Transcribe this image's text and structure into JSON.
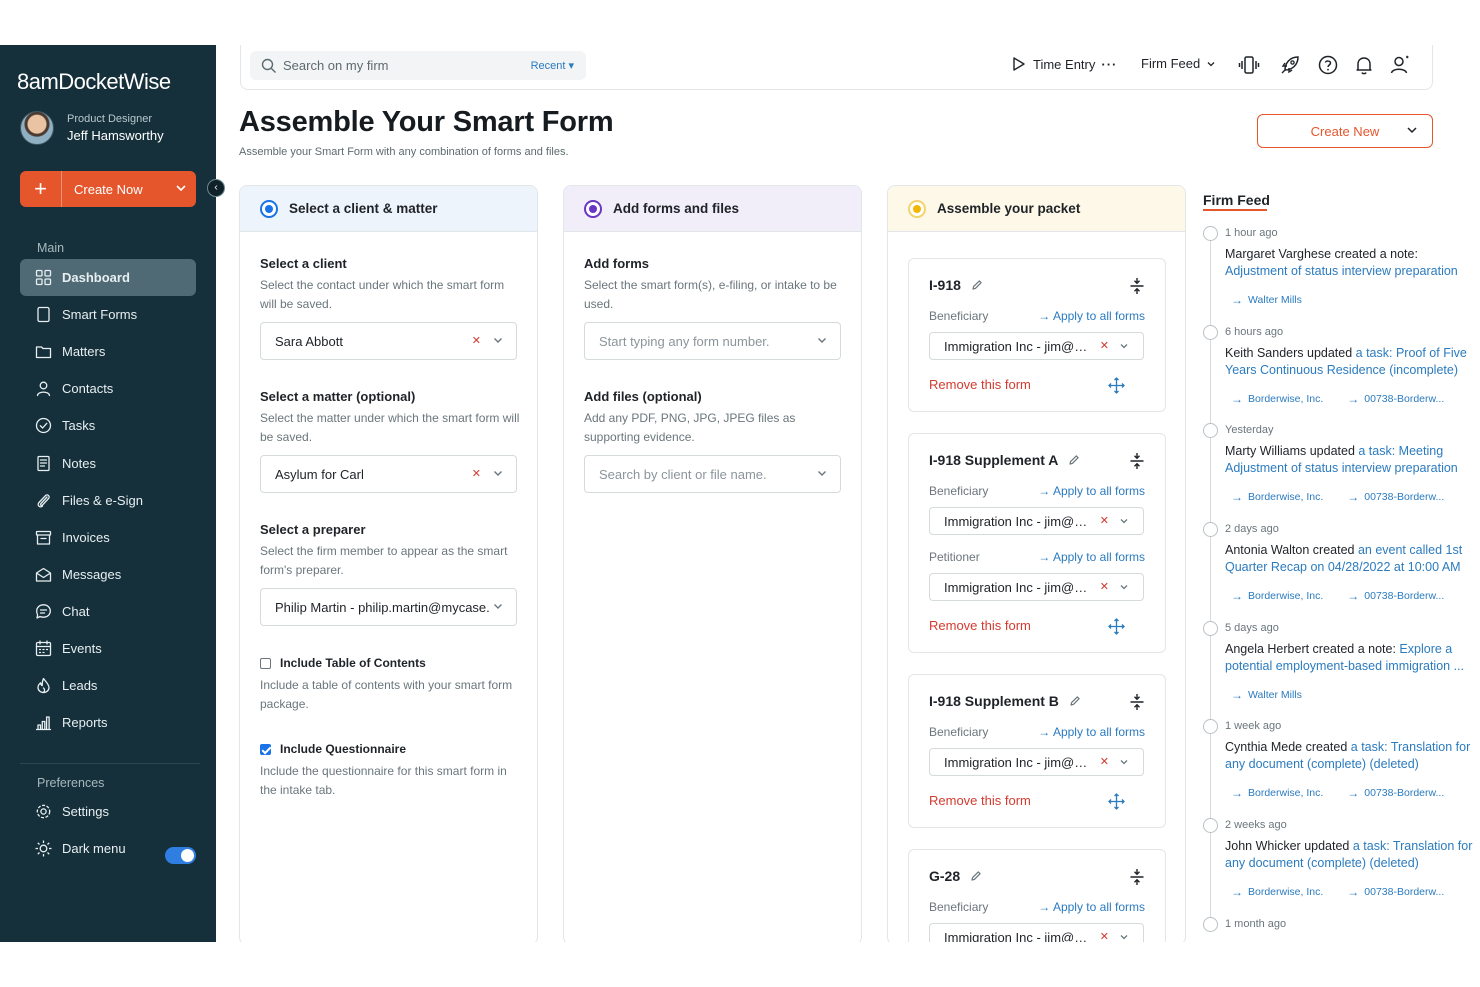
{
  "sidebar": {
    "logo": "8amDocketWise",
    "user": {
      "role": "Product Designer",
      "name": "Jeff Hamsworthy"
    },
    "create_label": "Create Now",
    "main_label": "Main",
    "items": [
      {
        "label": "Dashboard",
        "icon": "grid-icon"
      },
      {
        "label": "Smart Forms",
        "icon": "form-icon"
      },
      {
        "label": "Matters",
        "icon": "folder-icon"
      },
      {
        "label": "Contacts",
        "icon": "person-icon"
      },
      {
        "label": "Tasks",
        "icon": "check-circle-icon"
      },
      {
        "label": "Notes",
        "icon": "note-icon"
      },
      {
        "label": "Files & e-Sign",
        "icon": "paperclip-icon"
      },
      {
        "label": "Invoices",
        "icon": "invoice-icon"
      },
      {
        "label": "Messages",
        "icon": "envelope-icon"
      },
      {
        "label": "Chat",
        "icon": "chat-icon"
      },
      {
        "label": "Events",
        "icon": "calendar-icon"
      },
      {
        "label": "Leads",
        "icon": "flame-icon"
      },
      {
        "label": "Reports",
        "icon": "bar-chart-icon"
      }
    ],
    "prefs_label": "Preferences",
    "settings_label": "Settings",
    "dark_menu_label": "Dark menu",
    "dark_menu_on": true
  },
  "topbar": {
    "search_placeholder": "Search on my firm",
    "recent": "Recent ▾",
    "time_entry": "Time Entry",
    "firm_feed": "Firm Feed"
  },
  "page": {
    "title": "Assemble Your Smart Form",
    "subtitle": "Assemble your Smart Form with any combination of forms and files.",
    "create_new": "Create New"
  },
  "col1": {
    "header": "Select a client & matter",
    "client_title": "Select a client",
    "client_desc": "Select the contact under which the smart form will be saved.",
    "client_value": "Sara Abbott",
    "matter_title": "Select a matter (optional)",
    "matter_desc": "Select the matter under which the smart form will be saved.",
    "matter_value": "Asylum for Carl",
    "preparer_title": "Select a preparer",
    "preparer_desc": "Select the firm member to appear as the smart form's preparer.",
    "preparer_value": "Philip Martin - philip.martin@mycase.c",
    "toc_label": "Include Table of Contents",
    "toc_desc": "Include a table of contents with your smart form package.",
    "toc_checked": false,
    "questionnaire_label": "Include Questionnaire",
    "questionnaire_desc": "Include the questionnaire for this smart form in the intake tab.",
    "questionnaire_checked": true
  },
  "col2": {
    "header": "Add forms and files",
    "forms_title": "Add forms",
    "forms_desc": "Select the smart form(s), e-filing, or intake to be used.",
    "forms_placeholder": "Start typing any form number.",
    "files_title": "Add files (optional)",
    "files_desc": "Add any PDF, PNG, JPG, JPEG files as supporting evidence.",
    "files_placeholder": "Search by client or file name."
  },
  "col3": {
    "header": "Assemble your packet",
    "apply_label": "→ Apply to all forms",
    "remove_label": "Remove this form",
    "cards": [
      {
        "title": "I-918",
        "rows": [
          {
            "role": "Beneficiary",
            "value": "Immigration Inc - jim@gl…"
          }
        ]
      },
      {
        "title": "I-918 Supplement A",
        "rows": [
          {
            "role": "Beneficiary",
            "value": "Immigration Inc - jim@gl…"
          },
          {
            "role": "Petitioner",
            "value": "Immigration Inc - jim@gl…"
          }
        ]
      },
      {
        "title": "I-918 Supplement B",
        "rows": [
          {
            "role": "Beneficiary",
            "value": "Immigration Inc - jim@gl…"
          }
        ]
      },
      {
        "title": "G-28",
        "rows": [
          {
            "role": "Beneficiary",
            "value": "Immigration Inc - jim@gl…"
          }
        ]
      }
    ]
  },
  "feed": {
    "title": "Firm Feed",
    "entries": [
      {
        "time": "1 hour ago",
        "text": "Margaret Varghese created a note: ",
        "link": "Adjustment of status interview preparation",
        "chips": [
          "Walter Mills"
        ]
      },
      {
        "time": "6 hours ago",
        "text": "Keith Sanders updated ",
        "link": "a task: Proof of Five Years Continuous Residence (incomplete)",
        "chips": [
          "Borderwise, Inc.",
          "00738-Borderw..."
        ]
      },
      {
        "time": "Yesterday",
        "text": "Marty Williams updated ",
        "link": "a task: Meeting Adjustment of status interview preparation",
        "chips": [
          "Borderwise, Inc.",
          "00738-Borderw..."
        ]
      },
      {
        "time": "2 days ago",
        "text": "Antonia Walton created ",
        "link": "an event called 1st Quarter Recap on 04/28/2022 at 10:00 AM",
        "chips": [
          "Borderwise, Inc.",
          "00738-Borderw..."
        ]
      },
      {
        "time": "5 days ago",
        "text": "Angela Herbert created a note: ",
        "link": "Explore a potential employment-based immigration ...",
        "chips": [
          "Walter Mills"
        ]
      },
      {
        "time": "1 week ago",
        "text": "Cynthia Mede created ",
        "link": "a task: Translation for any document (complete) (deleted)",
        "chips": [
          "Borderwise, Inc.",
          "00738-Borderw..."
        ]
      },
      {
        "time": "2 weeks ago",
        "text": "John Whicker updated ",
        "link": "a task: Translation for any document (complete) (deleted)",
        "chips": [
          "Borderwise, Inc.",
          "00738-Borderw..."
        ]
      },
      {
        "time": "1 month ago",
        "text": "",
        "link": "",
        "chips": []
      }
    ]
  },
  "colors": {
    "sidebar": "#15303a",
    "accent": "#e5562d",
    "link": "#2b7bbf",
    "danger": "#d43b2f",
    "step1": "#1a73e8",
    "step2": "#6a35c4",
    "step3": "#f2b705"
  }
}
